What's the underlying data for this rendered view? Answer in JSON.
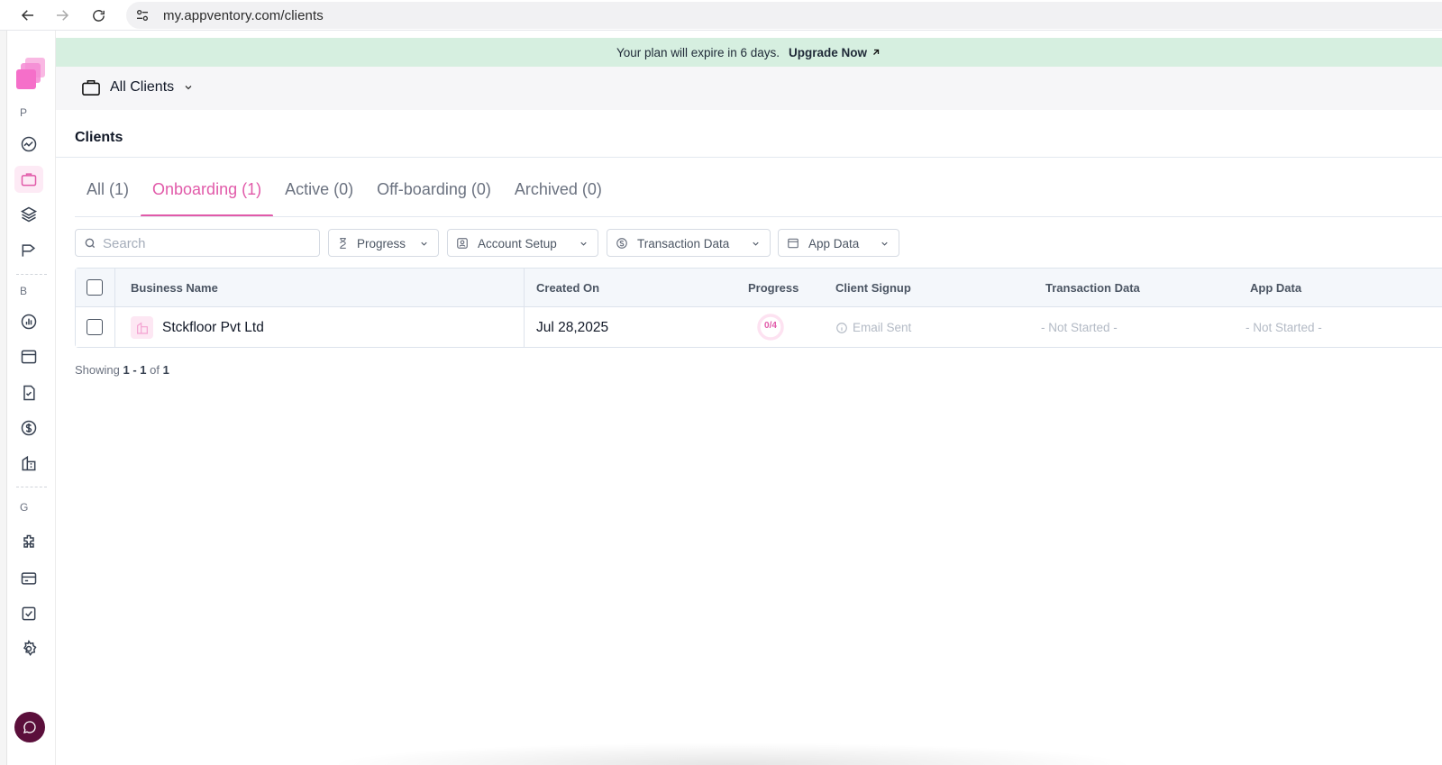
{
  "browser": {
    "url": "my.appventory.com/clients"
  },
  "sidebar": {
    "sections": [
      "P",
      "B",
      "G"
    ]
  },
  "banner": {
    "message": "Your plan will expire in 6 days.",
    "cta": "Upgrade Now"
  },
  "client_switcher": {
    "label": "All Clients"
  },
  "page": {
    "title": "Clients"
  },
  "tabs": [
    {
      "label": "All (1)",
      "active": false
    },
    {
      "label": "Onboarding (1)",
      "active": true
    },
    {
      "label": "Active (0)",
      "active": false
    },
    {
      "label": "Off-boarding (0)",
      "active": false
    },
    {
      "label": "Archived (0)",
      "active": false
    }
  ],
  "filters": {
    "search_placeholder": "Search",
    "progress": "Progress",
    "account_setup": "Account Setup",
    "transaction_data": "Transaction Data",
    "app_data": "App Data"
  },
  "table": {
    "columns": [
      "Business Name",
      "Created On",
      "Progress",
      "Client Signup",
      "Transaction Data",
      "App Data"
    ],
    "rows": [
      {
        "business_name": "Stckfloor Pvt Ltd",
        "created_on": "Jul 28,2025",
        "progress": "0/4",
        "client_signup": "Email Sent",
        "transaction_data": "- Not Started -",
        "app_data": "- Not Started -"
      }
    ]
  },
  "pagination": {
    "prefix": "Showing",
    "range": "1 - 1",
    "of": "of",
    "total": "1"
  },
  "colors": {
    "accent": "#e15aa9",
    "banner_bg": "#d6efe0",
    "chat_button": "#5b0f3b"
  }
}
